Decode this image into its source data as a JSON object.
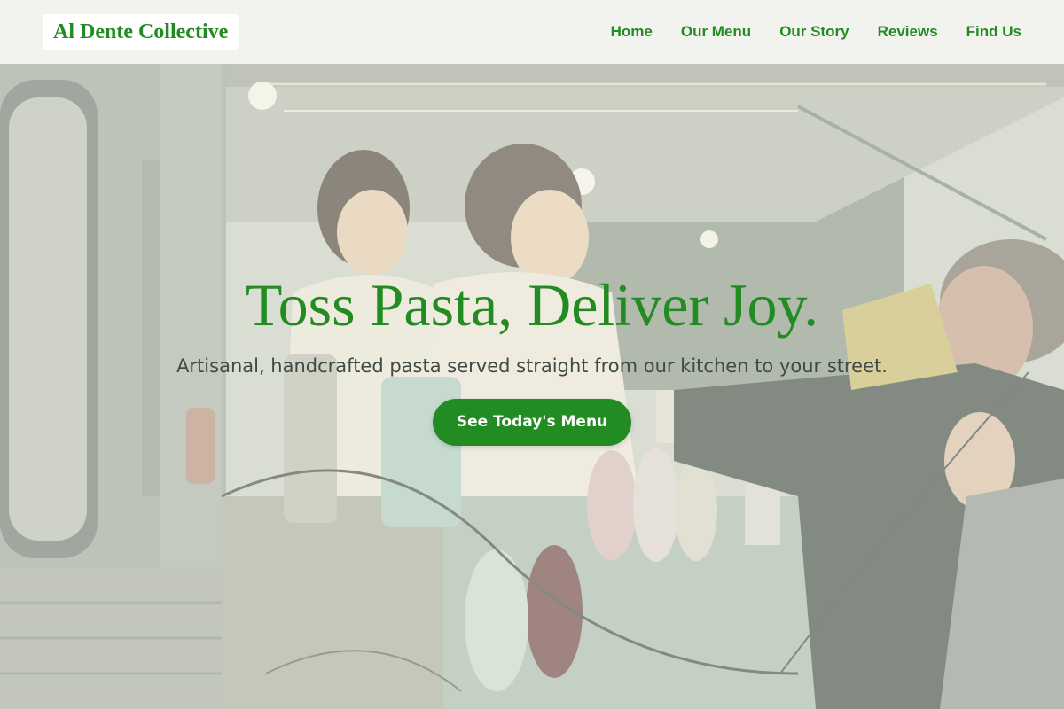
{
  "brand": {
    "name": "Al Dente Collective",
    "color": "#228b22"
  },
  "nav": {
    "links": [
      {
        "label": "Home"
      },
      {
        "label": "Our Menu"
      },
      {
        "label": "Our Story"
      },
      {
        "label": "Reviews"
      },
      {
        "label": "Find Us"
      }
    ]
  },
  "hero": {
    "title": "Toss Pasta, Deliver Joy.",
    "tagline": "Artisanal, handcrafted pasta served straight from our kitchen to your street.",
    "cta_label": "See Today's Menu",
    "background": "food-truck-counter-photo"
  },
  "colors": {
    "accent": "#228b22",
    "tagline": "#3f4a45",
    "cta_text": "#ffffff"
  }
}
